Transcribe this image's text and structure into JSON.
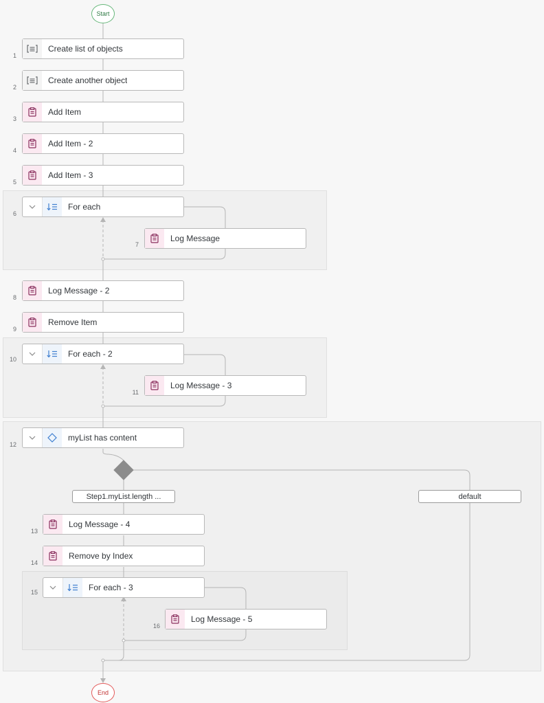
{
  "terminals": {
    "start": "Start",
    "end": "End"
  },
  "steps": [
    {
      "num": "1",
      "label": "Create list of objects",
      "icon": "script-icon"
    },
    {
      "num": "2",
      "label": "Create another object",
      "icon": "script-icon"
    },
    {
      "num": "3",
      "label": "Add Item",
      "icon": "clipboard-icon"
    },
    {
      "num": "4",
      "label": "Add Item - 2",
      "icon": "clipboard-icon"
    },
    {
      "num": "5",
      "label": "Add Item - 3",
      "icon": "clipboard-icon"
    },
    {
      "num": "6",
      "label": "For each",
      "icon": "loop-icon"
    },
    {
      "num": "7",
      "label": "Log Message",
      "icon": "clipboard-icon"
    },
    {
      "num": "8",
      "label": "Log Message - 2",
      "icon": "clipboard-icon"
    },
    {
      "num": "9",
      "label": "Remove Item",
      "icon": "clipboard-icon"
    },
    {
      "num": "10",
      "label": "For each - 2",
      "icon": "loop-icon"
    },
    {
      "num": "11",
      "label": "Log Message - 3",
      "icon": "clipboard-icon"
    },
    {
      "num": "12",
      "label": "myList has content",
      "icon": "diamond-icon"
    },
    {
      "num": "13",
      "label": "Log Message - 4",
      "icon": "clipboard-icon"
    },
    {
      "num": "14",
      "label": "Remove by Index",
      "icon": "clipboard-icon"
    },
    {
      "num": "15",
      "label": "For each - 3",
      "icon": "loop-icon"
    },
    {
      "num": "16",
      "label": "Log Message - 5",
      "icon": "clipboard-icon"
    }
  ],
  "branches": {
    "condition": "Step1.myList.length ...",
    "default": "default"
  },
  "colors": {
    "start_green": "#66b77a",
    "end_red": "#e35a5a",
    "action_accent": "#8a2f5e",
    "loop_accent": "#3f7fd0",
    "gateway_gray": "#8c8c8c"
  }
}
